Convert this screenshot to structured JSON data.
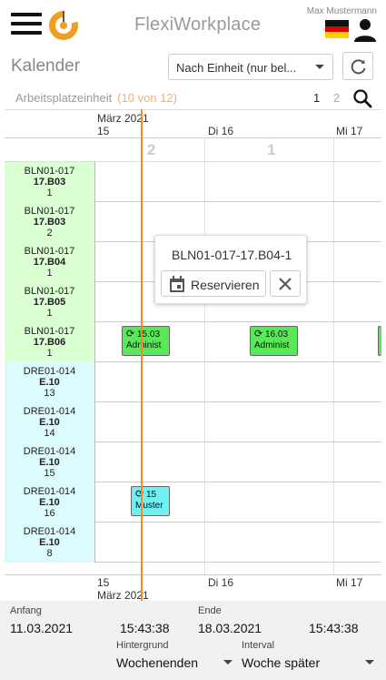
{
  "header": {
    "app_title": "FlexiWorkplace",
    "user_name": "Max Mustermann",
    "menu_icon": "hamburger-icon",
    "logo_icon": "flexiworkplace-logo",
    "flag_icon": "germany-flag-icon",
    "user_icon": "user-icon"
  },
  "toolbar": {
    "page_title": "Kalender",
    "view_select_value": "Nach Einheit (nur bel...",
    "refresh_icon": "refresh-icon"
  },
  "filter": {
    "unit_label": "Arbeitsplatzeinheit",
    "unit_count": "(10 von 12)",
    "pages": [
      "1",
      "2"
    ],
    "current_page": "1",
    "search_icon": "search-icon"
  },
  "calendar": {
    "month_label": "März 2021",
    "days": [
      "15",
      "Di 16",
      "Mi 17"
    ],
    "day_counts": [
      "2",
      "1"
    ],
    "resources": [
      {
        "line1": "BLN01-017",
        "line2": "17.B03",
        "line3": "1",
        "type": "bln"
      },
      {
        "line1": "BLN01-017",
        "line2": "17.B03",
        "line3": "2",
        "type": "bln"
      },
      {
        "line1": "BLN01-017",
        "line2": "17.B04",
        "line3": "1",
        "type": "bln"
      },
      {
        "line1": "BLN01-017",
        "line2": "17.B05",
        "line3": "1",
        "type": "bln"
      },
      {
        "line1": "BLN01-017",
        "line2": "17.B06",
        "line3": "1",
        "type": "bln"
      },
      {
        "line1": "DRE01-014",
        "line2": "E.10",
        "line3": "13",
        "type": "dre"
      },
      {
        "line1": "DRE01-014",
        "line2": "E.10",
        "line3": "14",
        "type": "dre"
      },
      {
        "line1": "DRE01-014",
        "line2": "E.10",
        "line3": "15",
        "type": "dre"
      },
      {
        "line1": "DRE01-014",
        "line2": "E.10",
        "line3": "16",
        "type": "dre"
      },
      {
        "line1": "DRE01-014",
        "line2": "E.10",
        "line3": "8",
        "type": "dre"
      }
    ],
    "bookings": [
      {
        "line1": "15.03",
        "line2": "Administ",
        "color": "#58e858"
      },
      {
        "line1": "16.03",
        "line2": "Administ",
        "color": "#58e858"
      },
      {
        "line1": "15",
        "line2": "Muster",
        "color": "#6ff0f2"
      }
    ],
    "booking_icon": "recurring-icon",
    "now_line_color": "#f08a2a"
  },
  "popup": {
    "title": "BLN01-017-17.B04-1",
    "reserve_label": "Reservieren",
    "calendar_icon": "calendar-icon",
    "close_icon": "close-icon"
  },
  "bottom": {
    "start_label": "Anfang",
    "start_date": "11.03.2021",
    "start_time": "15:43:38",
    "end_label": "Ende",
    "end_date": "18.03.2021",
    "end_time": "15:43:38",
    "background_label": "Hintergrund",
    "background_value": "Wochenenden",
    "interval_label": "Interval",
    "interval_value": "Woche später"
  },
  "colors": {
    "bln_bg": "#d9ffd2",
    "dre_bg": "#dcfbfc",
    "accent": "#f08a2a",
    "count_highlight": "#f0b070"
  }
}
